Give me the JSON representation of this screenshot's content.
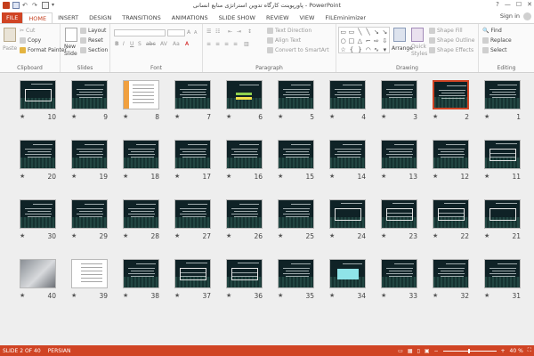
{
  "window": {
    "title": "پاورپوینت کارگاه تدوین استراتژی منابع انسانی - PowerPoint",
    "controls": [
      "?",
      "—",
      "☐",
      "✕"
    ]
  },
  "tabs": [
    {
      "id": "file",
      "label": "FILE"
    },
    {
      "id": "home",
      "label": "HOME",
      "active": true
    },
    {
      "id": "insert",
      "label": "INSERT"
    },
    {
      "id": "design",
      "label": "DESIGN"
    },
    {
      "id": "transitions",
      "label": "TRANSITIONS"
    },
    {
      "id": "animations",
      "label": "ANIMATIONS"
    },
    {
      "id": "slideshow",
      "label": "SLIDE SHOW"
    },
    {
      "id": "review",
      "label": "REVIEW"
    },
    {
      "id": "view",
      "label": "VIEW"
    },
    {
      "id": "fileminimizer",
      "label": "FILEminimizer"
    }
  ],
  "account": {
    "signin": "Sign in"
  },
  "ribbon": {
    "clipboard": {
      "label": "Clipboard",
      "paste": "Paste",
      "cut": "Cut",
      "copy": "Copy",
      "format_painter": "Format Painter"
    },
    "slides": {
      "label": "Slides",
      "new_slide_1": "New",
      "new_slide_2": "Slide",
      "layout": "Layout",
      "reset": "Reset",
      "section": "Section"
    },
    "font": {
      "label": "Font"
    },
    "paragraph": {
      "label": "Paragraph",
      "text_direction": "Text Direction",
      "align_text": "Align Text",
      "convert_smartart": "Convert to SmartArt"
    },
    "drawing": {
      "label": "Drawing",
      "arrange": "Arrange",
      "quick_styles_1": "Quick",
      "quick_styles_2": "Styles",
      "shape_fill": "Shape Fill",
      "shape_outline": "Shape Outline",
      "shape_effects": "Shape Effects"
    },
    "editing": {
      "label": "Editing",
      "find": "Find",
      "replace": "Replace",
      "select": "Select"
    }
  },
  "slides": [
    {
      "n": "1",
      "style": "title"
    },
    {
      "n": "2",
      "style": "text",
      "selected": true
    },
    {
      "n": "3",
      "style": "text"
    },
    {
      "n": "4",
      "style": "text"
    },
    {
      "n": "5",
      "style": "text"
    },
    {
      "n": "6",
      "style": "highlight"
    },
    {
      "n": "7",
      "style": "text"
    },
    {
      "n": "8",
      "style": "orange"
    },
    {
      "n": "9",
      "style": "text"
    },
    {
      "n": "10",
      "style": "diagram"
    },
    {
      "n": "11",
      "style": "table"
    },
    {
      "n": "12",
      "style": "text"
    },
    {
      "n": "13",
      "style": "text"
    },
    {
      "n": "14",
      "style": "text"
    },
    {
      "n": "15",
      "style": "text"
    },
    {
      "n": "16",
      "style": "text"
    },
    {
      "n": "17",
      "style": "text"
    },
    {
      "n": "18",
      "style": "text"
    },
    {
      "n": "19",
      "style": "text"
    },
    {
      "n": "20",
      "style": "text"
    },
    {
      "n": "21",
      "style": "diagram"
    },
    {
      "n": "22",
      "style": "table"
    },
    {
      "n": "23",
      "style": "table"
    },
    {
      "n": "24",
      "style": "diagram"
    },
    {
      "n": "25",
      "style": "text"
    },
    {
      "n": "26",
      "style": "text"
    },
    {
      "n": "27",
      "style": "text"
    },
    {
      "n": "28",
      "style": "text"
    },
    {
      "n": "29",
      "style": "text"
    },
    {
      "n": "30",
      "style": "text"
    },
    {
      "n": "31",
      "style": "text"
    },
    {
      "n": "32",
      "style": "text"
    },
    {
      "n": "33",
      "style": "text"
    },
    {
      "n": "34",
      "style": "cyan"
    },
    {
      "n": "35",
      "style": "text"
    },
    {
      "n": "36",
      "style": "table"
    },
    {
      "n": "37",
      "style": "table"
    },
    {
      "n": "38",
      "style": "text"
    },
    {
      "n": "39",
      "style": "light"
    },
    {
      "n": "40",
      "style": "photo"
    }
  ],
  "status": {
    "slide_of": "SLIDE 2 OF 40",
    "language": "PERSIAN",
    "zoom": "40 %"
  }
}
